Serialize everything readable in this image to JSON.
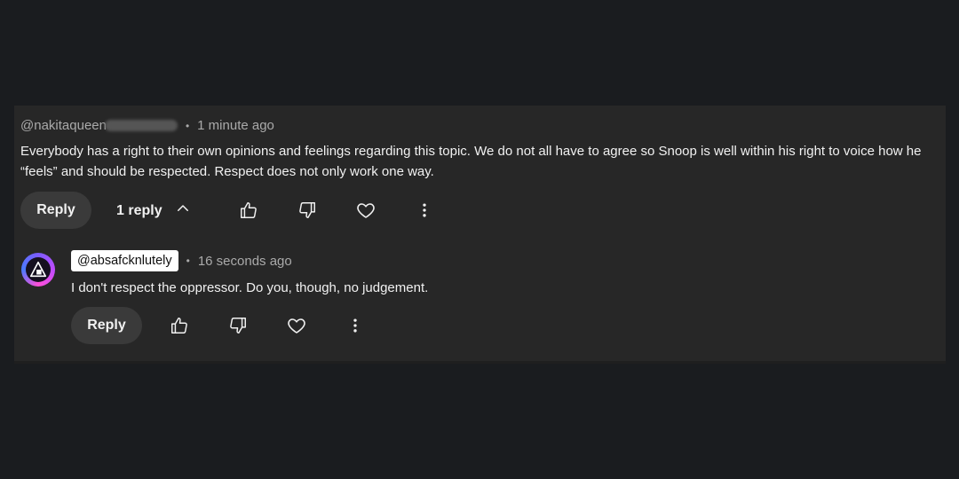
{
  "comment": {
    "author": "@nakitaqueen",
    "timestamp": "1 minute ago",
    "text_line1": "Everybody has a right to their own opinions and feelings regarding this topic. We do not all have to agree so Snoop is well within his right to voice how he",
    "text_line2": "“feels” and should be respected. Respect does not only work one way.",
    "reply_label": "Reply",
    "replies_label": "1 reply"
  },
  "reply": {
    "author": "@absafcknlutely",
    "timestamp": "16 seconds ago",
    "text": "I don't respect the oppressor. Do you, though, no judgement.",
    "reply_label": "Reply"
  },
  "icons": {
    "like": "thumbs-up-icon",
    "dislike": "thumbs-down-icon",
    "heart": "heart-icon",
    "more": "more-vert-icon",
    "chevron": "chevron-up-icon"
  }
}
